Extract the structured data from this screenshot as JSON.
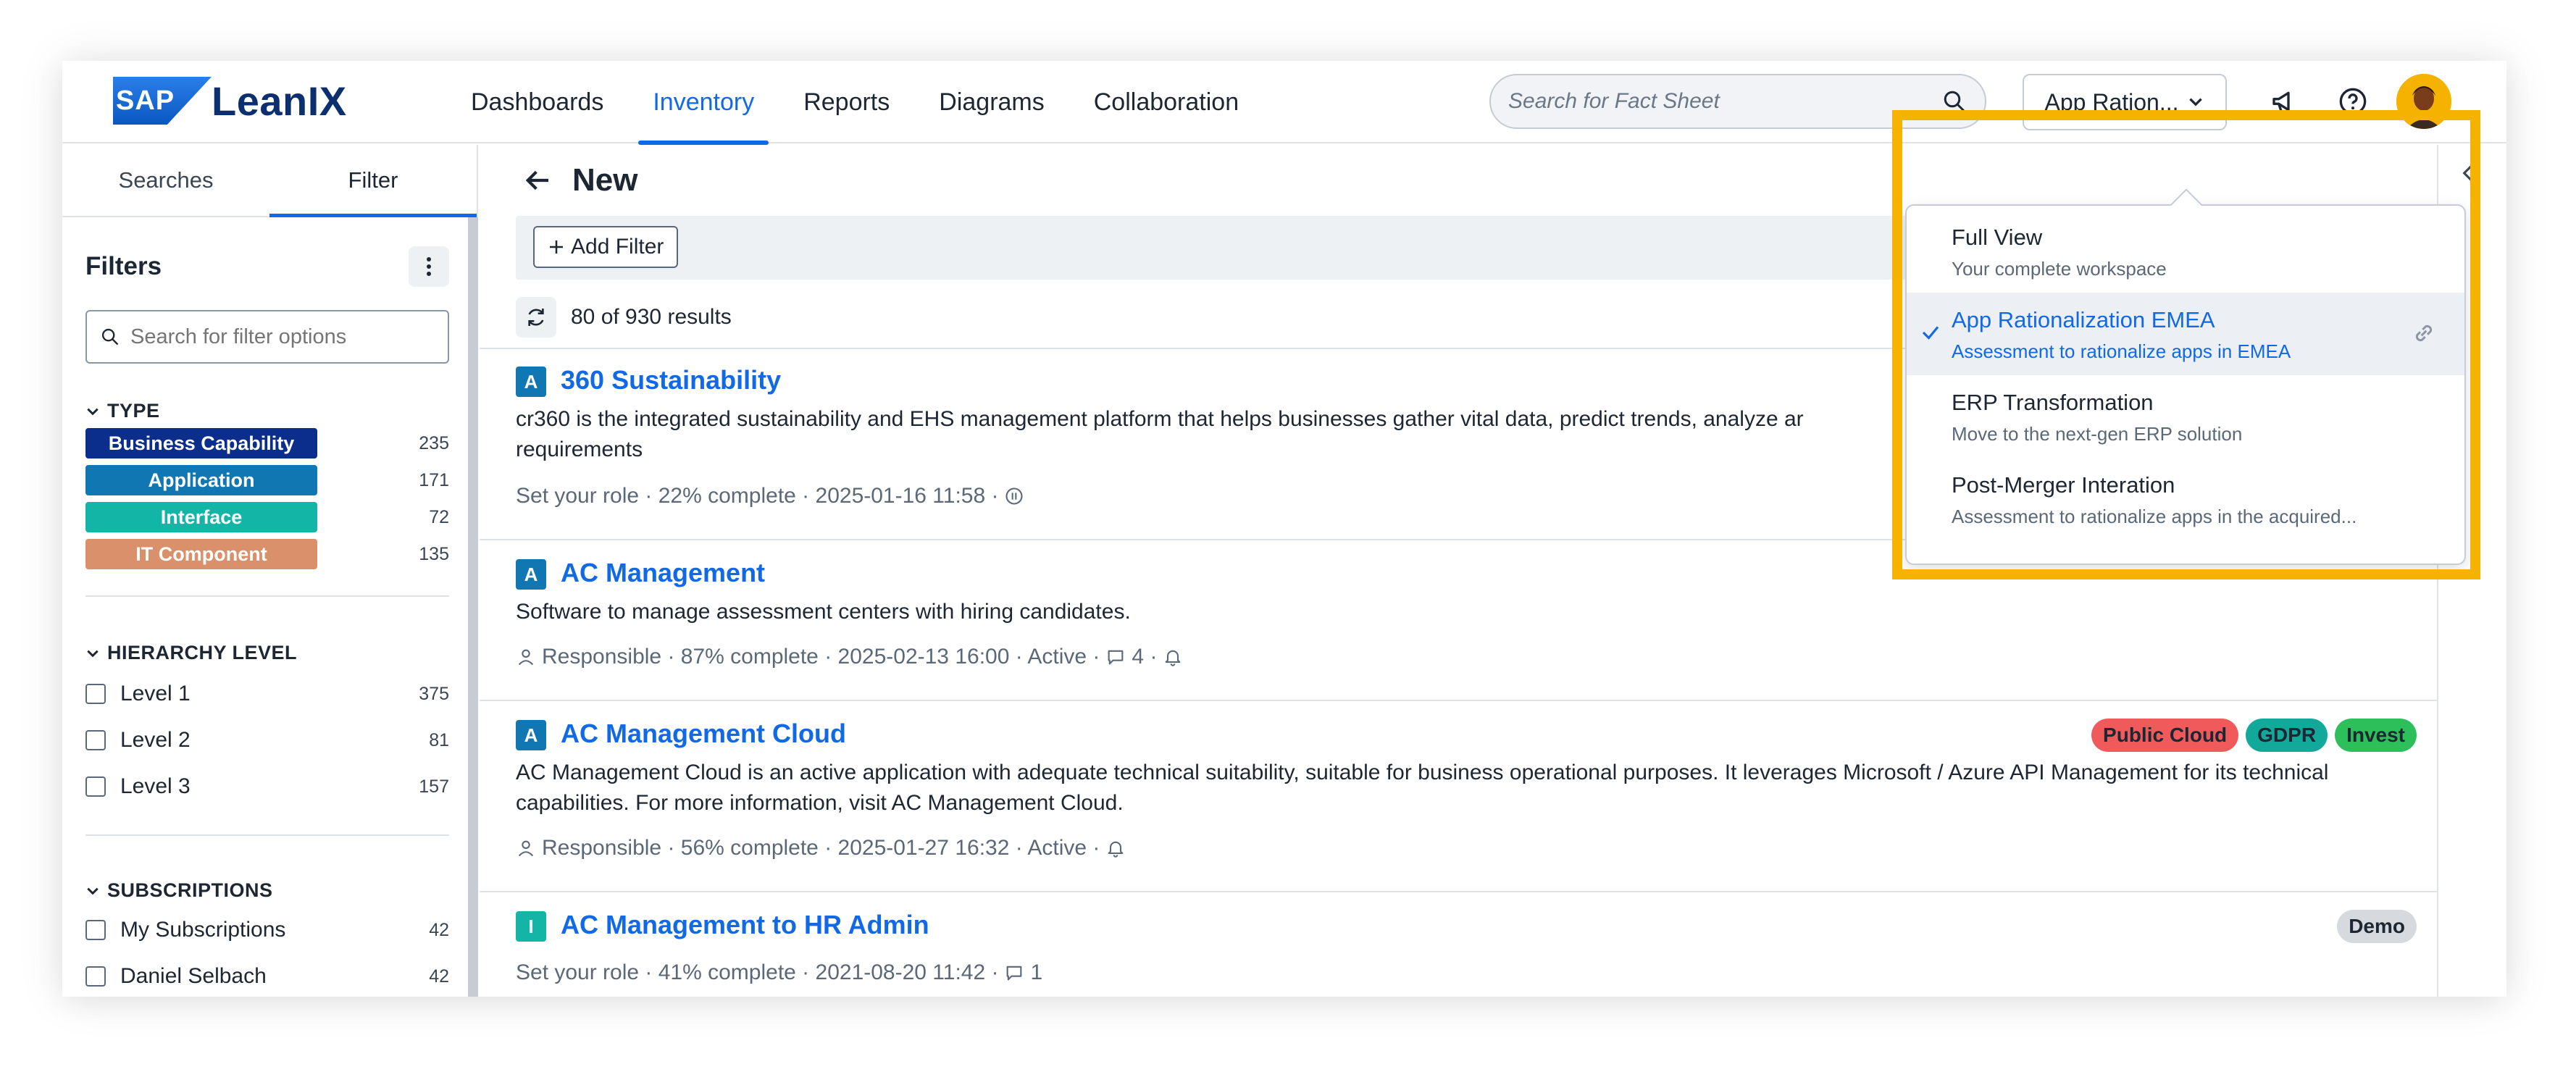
{
  "brand": {
    "sap": "SAP",
    "product": "LeanIX"
  },
  "nav": [
    {
      "label": "Dashboards",
      "active": false
    },
    {
      "label": "Inventory",
      "active": true
    },
    {
      "label": "Reports",
      "active": false
    },
    {
      "label": "Diagrams",
      "active": false
    },
    {
      "label": "Collaboration",
      "active": false
    }
  ],
  "search": {
    "placeholder": "Search for Fact Sheet"
  },
  "view_button": {
    "label": "App Ration..."
  },
  "colors": {
    "accent": "#1169e6",
    "highlight": "#f5b300"
  },
  "sidebar": {
    "tabs": [
      {
        "label": "Searches"
      },
      {
        "label": "Filter"
      }
    ],
    "filters_title": "Filters",
    "filter_search_placeholder": "Search for filter options",
    "type": {
      "header": "TYPE",
      "items": [
        {
          "label": "Business Capability",
          "count": "235",
          "color": "#0b2e8c"
        },
        {
          "label": "Application",
          "count": "171",
          "color": "#1077b3"
        },
        {
          "label": "Interface",
          "count": "72",
          "color": "#12b5a6"
        },
        {
          "label": "IT Component",
          "count": "135",
          "color": "#d9906b"
        }
      ]
    },
    "hierarchy": {
      "header": "HIERARCHY LEVEL",
      "items": [
        {
          "label": "Level 1",
          "count": "375"
        },
        {
          "label": "Level 2",
          "count": "81"
        },
        {
          "label": "Level 3",
          "count": "157"
        }
      ]
    },
    "subscriptions": {
      "header": "SUBSCRIPTIONS",
      "items": [
        {
          "label": "My Subscriptions",
          "count": "42"
        },
        {
          "label": "Daniel Selbach",
          "count": "42"
        }
      ]
    }
  },
  "main": {
    "title": "New",
    "add_filter": "Add Filter",
    "results": "80 of 930 results",
    "items": [
      {
        "letter": "A",
        "letter_color": "#1077b3",
        "name": "360 Sustainability",
        "desc": "cr360 is the integrated sustainability and EHS management platform that helps businesses gather vital data, predict trends, analyze ar",
        "desc2": "requirements",
        "meta": "Set your role · 22% complete · 2025-01-16 11:58 ·"
      },
      {
        "letter": "A",
        "letter_color": "#1077b3",
        "name": "AC Management",
        "desc": "Software to manage assessment centers with hiring candidates.",
        "meta_a": "Responsible · 87% complete · 2025-02-13 16:00 · Active ·",
        "meta_b": "4 ·"
      },
      {
        "letter": "A",
        "letter_color": "#1077b3",
        "name": "AC Management Cloud",
        "desc": "AC Management Cloud is an active application with adequate technical suitability, suitable for business operational purposes. It leverages Microsoft / Azure API Management for its technical capabilities. For more information, visit AC Management Cloud.",
        "meta": "Responsible · 56% complete · 2025-01-27 16:32 · Active ·",
        "tags": [
          {
            "label": "Public Cloud",
            "color": "#f05a5a"
          },
          {
            "label": "GDPR",
            "color": "#12a99a"
          },
          {
            "label": "Invest",
            "color": "#2dbf5a"
          }
        ]
      },
      {
        "letter": "I",
        "letter_color": "#12b5a6",
        "name": "AC Management to HR Admin",
        "meta_a": "Set your role · 41% complete · 2021-08-20 11:42 ·",
        "meta_b": "1",
        "tags": [
          {
            "label": "Demo",
            "color": "#d6d9dd"
          }
        ]
      }
    ]
  },
  "dropdown": {
    "items": [
      {
        "name": "Full View",
        "sub": "Your complete workspace",
        "selected": false
      },
      {
        "name": "App Rationalization EMEA",
        "sub": "Assessment to rationalize apps in EMEA",
        "selected": true
      },
      {
        "name": "ERP Transformation",
        "sub": "Move to the next-gen ERP solution",
        "selected": false
      },
      {
        "name": "Post-Merger Interation",
        "sub": "Assessment to rationalize apps in the acquired...",
        "selected": false
      }
    ]
  }
}
